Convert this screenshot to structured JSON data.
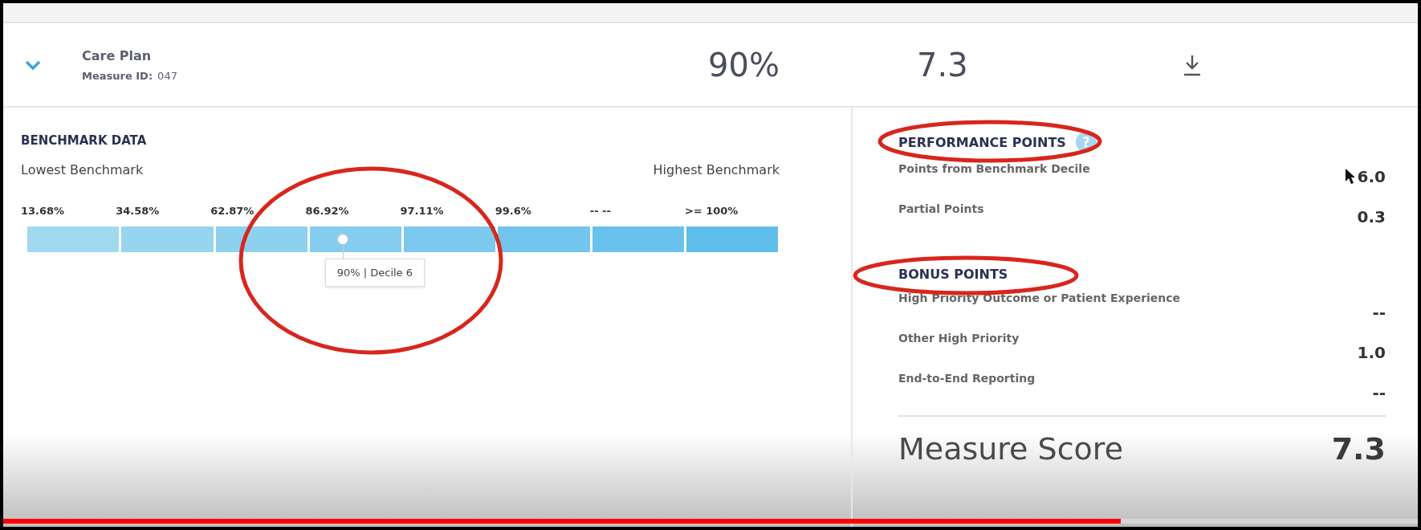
{
  "measure": {
    "title": "Care Plan",
    "id_label": "Measure ID:",
    "id_value": "047",
    "expanded": true,
    "performance_rate": "90%",
    "score": "7.3"
  },
  "benchmark": {
    "title": "BENCHMARK DATA",
    "lowest_label": "Lowest Benchmark",
    "highest_label": "Highest Benchmark",
    "deciles": [
      "13.68%",
      "34.58%",
      "62.87%",
      "86.92%",
      "97.11%",
      "99.6%",
      "-- --",
      ">= 100%"
    ],
    "marker": {
      "level": 0.42,
      "tooltip": "90% | Decile 6",
      "circled": true
    }
  },
  "performance": {
    "title": "PERFORMANCE POINTS",
    "circled": true,
    "help_icon": "?",
    "rows": [
      {
        "label": "Points from Benchmark Decile",
        "value": "6.0"
      },
      {
        "label": "Partial Points",
        "value": "0.3"
      }
    ]
  },
  "bonus": {
    "title": "BONUS POINTS",
    "circled": true,
    "rows": [
      {
        "label": "High Priority Outcome or Patient Experience",
        "value": "--"
      },
      {
        "label": "Other High Priority",
        "value": "1.0"
      },
      {
        "label": "End-to-End Reporting",
        "value": "--"
      }
    ]
  },
  "total": {
    "label": "Measure Score",
    "value": "7.3"
  },
  "video_progress": {
    "level": 0.79
  }
}
